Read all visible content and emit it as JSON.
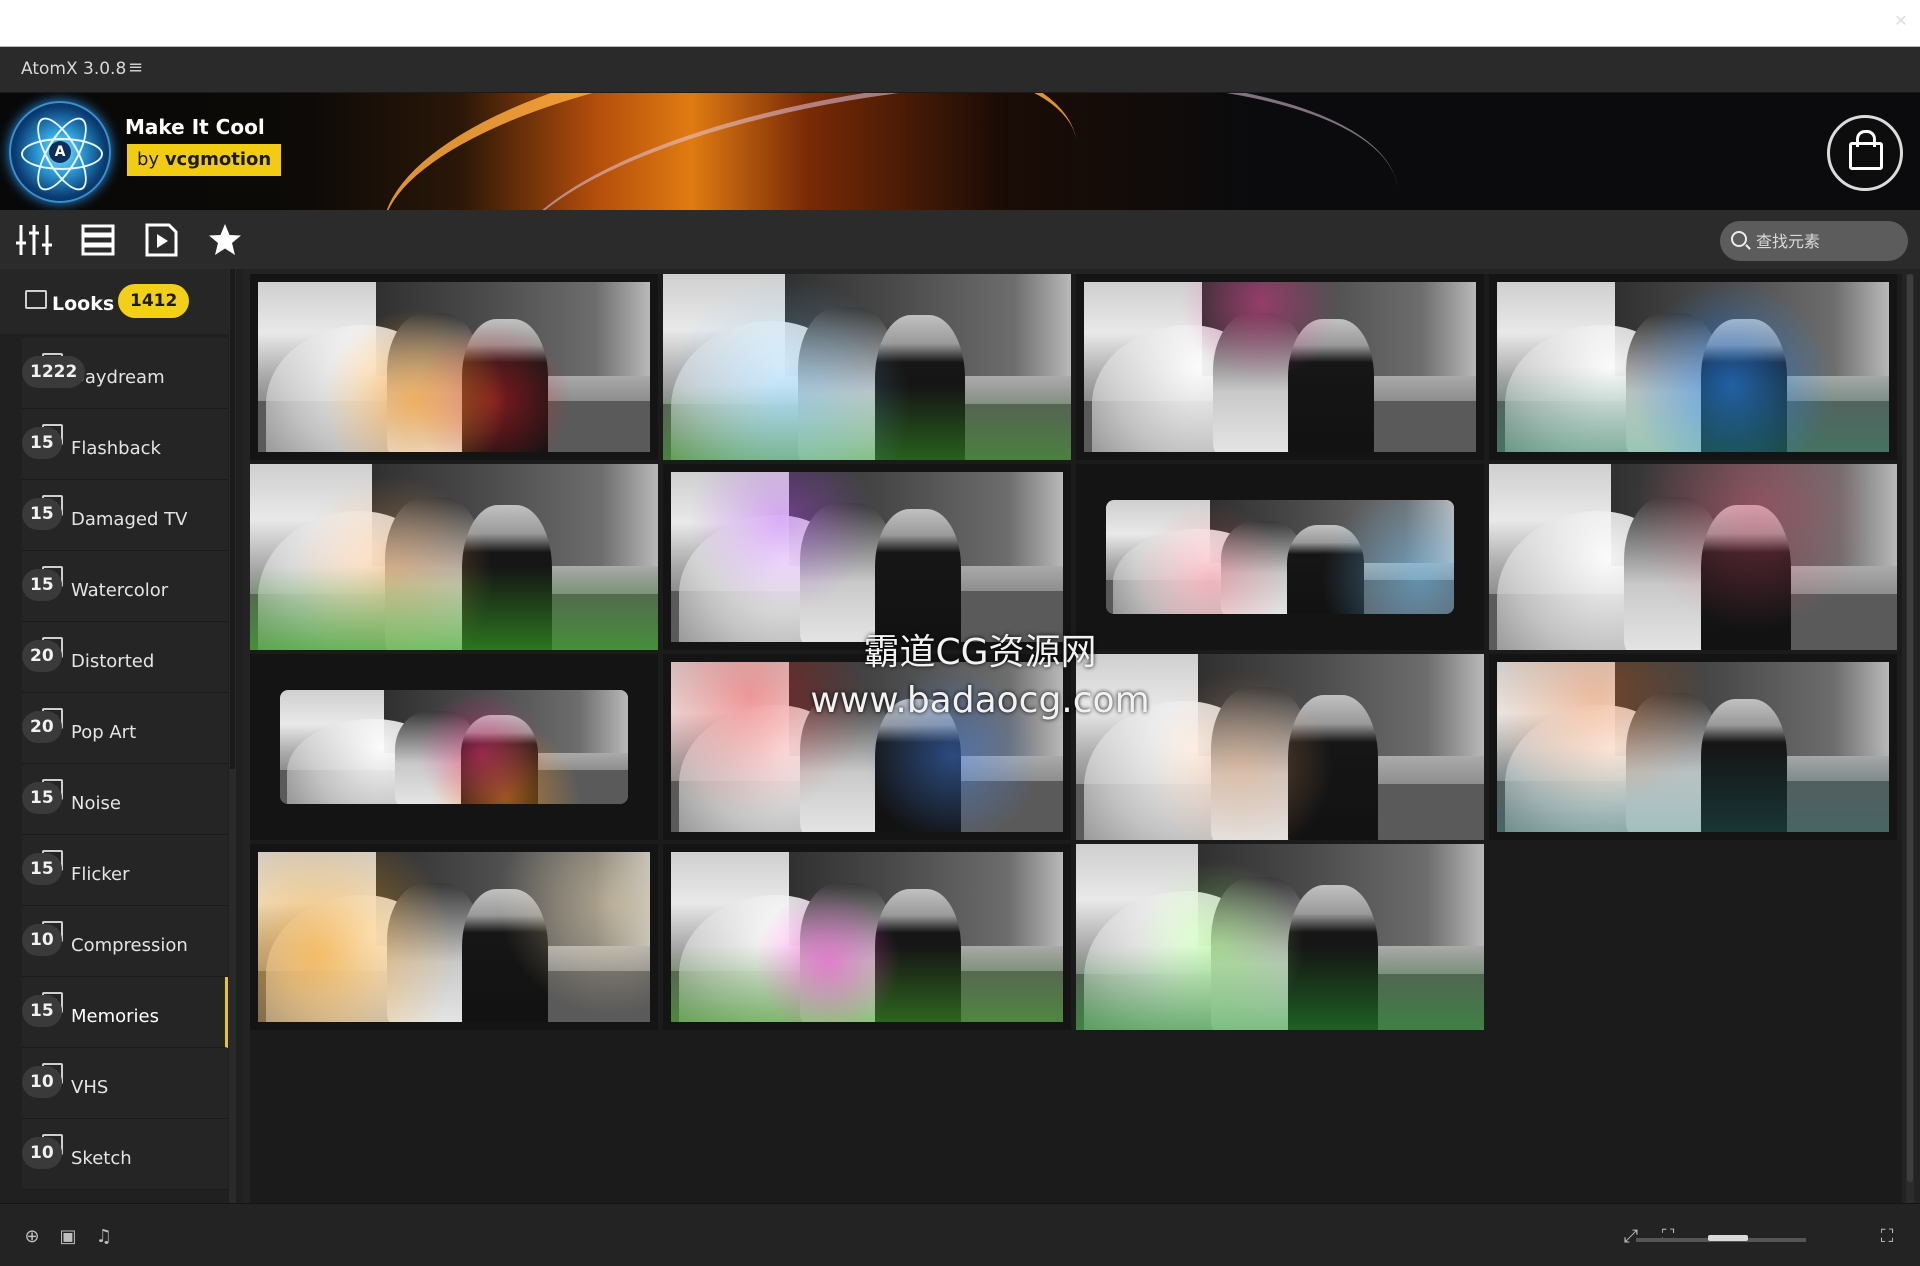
{
  "app": {
    "title": "AtomX 3.0.8",
    "menu_glyph": "≡"
  },
  "banner": {
    "pack_title": "Make It Cool",
    "by_prefix": "by",
    "author": "vcgmotion"
  },
  "toolbar": {
    "icons": [
      "sliders-icon",
      "list-icon",
      "media-icon",
      "star-icon"
    ],
    "search": {
      "placeholder": "查找元素",
      "value": ""
    }
  },
  "sidebar": {
    "root": {
      "label": "Looks",
      "count": "1412"
    },
    "categories": [
      {
        "label": "Daydream",
        "count": "1222"
      },
      {
        "label": "Flashback",
        "count": "15"
      },
      {
        "label": "Damaged TV",
        "count": "15"
      },
      {
        "label": "Watercolor",
        "count": "15"
      },
      {
        "label": "Distorted",
        "count": "20"
      },
      {
        "label": "Pop Art",
        "count": "20"
      },
      {
        "label": "Noise",
        "count": "15"
      },
      {
        "label": "Flicker",
        "count": "15"
      },
      {
        "label": "Compression",
        "count": "10"
      },
      {
        "label": "Memories",
        "count": "15"
      },
      {
        "label": "VHS",
        "count": "10"
      },
      {
        "label": "Sketch",
        "count": "10"
      }
    ],
    "active_index": 9
  },
  "grid": {
    "tiles": [
      {
        "style": "inset",
        "tint": "red-amber-left"
      },
      {
        "style": "full",
        "tint": "rainbow-green"
      },
      {
        "style": "inset",
        "tint": "magenta-gray"
      },
      {
        "style": "inset",
        "tint": "blue-cyan"
      },
      {
        "style": "full",
        "tint": "green-warm"
      },
      {
        "style": "inset",
        "tint": "purple-gray"
      },
      {
        "style": "small",
        "tint": "pink-cyan"
      },
      {
        "style": "full",
        "tint": "dusty-rose"
      },
      {
        "style": "small",
        "tint": "magenta-orange"
      },
      {
        "style": "inset",
        "tint": "red-blue"
      },
      {
        "style": "full",
        "tint": "warm-gray"
      },
      {
        "style": "inset",
        "tint": "orange-teal"
      },
      {
        "style": "inset",
        "tint": "golden-sunset"
      },
      {
        "style": "inset",
        "tint": "pink-green"
      },
      {
        "style": "full",
        "tint": "green-rainbow"
      }
    ]
  },
  "watermark": {
    "line1": "霸道CG资源网",
    "line2": "www.badaocg.com"
  },
  "bottombar": {
    "left_icons": [
      "target-icon",
      "play-square-icon",
      "music-note-icon"
    ],
    "right_icons": [
      "fit-icon",
      "expand-icon",
      "fullscreen-icon"
    ],
    "zoom_level": 0.55
  }
}
